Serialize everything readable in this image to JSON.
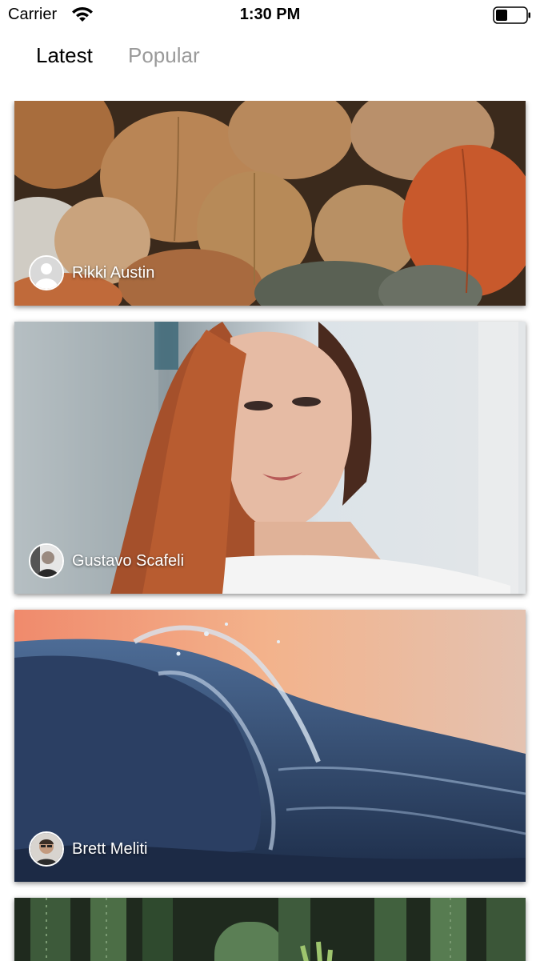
{
  "status_bar": {
    "carrier": "Carrier",
    "time": "1:30 PM",
    "wifi_icon": "wifi-icon",
    "battery_icon": "battery-icon"
  },
  "tabs": [
    {
      "label": "Latest",
      "active": true
    },
    {
      "label": "Popular",
      "active": false
    }
  ],
  "feed": {
    "photos": [
      {
        "subject": "pumpkins",
        "author": "Rikki Austin",
        "avatar": "default-avatar-icon"
      },
      {
        "subject": "portrait",
        "author": "Gustavo Scafeli",
        "avatar": "avatar-photo"
      },
      {
        "subject": "ocean-wave",
        "author": "Brett Meliti",
        "avatar": "avatar-photo"
      },
      {
        "subject": "cactus",
        "author": "",
        "avatar": ""
      }
    ]
  },
  "colors": {
    "tab_active": "#000000",
    "tab_inactive": "#9a9a9a",
    "background": "#ffffff"
  }
}
